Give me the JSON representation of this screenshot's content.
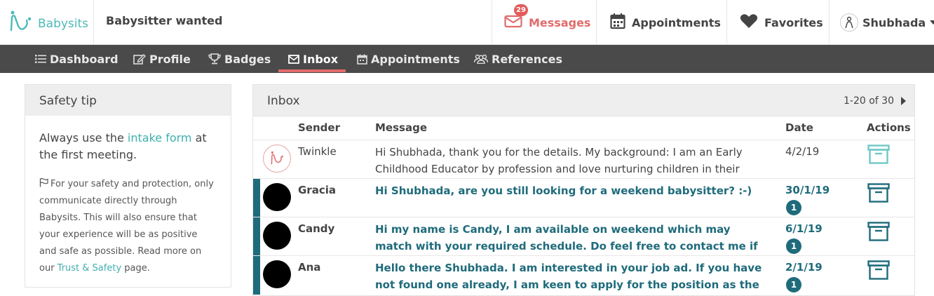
{
  "header": {
    "logo_text": "Babysits",
    "page_title": "Babysitter wanted",
    "messages": {
      "label": "Messages",
      "count": "29"
    },
    "appointments_label": "Appointments",
    "favorites_label": "Favorites",
    "user_name": "Shubhada"
  },
  "nav": {
    "items": [
      {
        "label": "Dashboard",
        "icon": "list-icon"
      },
      {
        "label": "Profile",
        "icon": "edit-icon"
      },
      {
        "label": "Badges",
        "icon": "trophy-icon"
      },
      {
        "label": "Inbox",
        "icon": "envelope-icon",
        "active": true
      },
      {
        "label": "Appointments",
        "icon": "calendar-icon"
      },
      {
        "label": "References",
        "icon": "users-icon"
      }
    ]
  },
  "sidebar": {
    "title": "Safety tip",
    "tip_before": "Always use the ",
    "tip_link": "intake form",
    "tip_after": " at the first meeting.",
    "note_before": "For your safety and protection, only communicate directly through Babysits. This will also ensure that your experience will be as positive and safe as possible. Read more on our ",
    "note_link": "Trust & Safety",
    "note_after": " page."
  },
  "inbox": {
    "title": "Inbox",
    "pager": "1-20 of 30",
    "columns": {
      "sender": "Sender",
      "message": "Message",
      "date": "Date",
      "actions": "Actions"
    },
    "rows": [
      {
        "sender": "Twinkle",
        "message": "Hi Shubhada, thank you for the details. My background: I am an Early Childhood Educator by profession and love nurturing children in their",
        "date": "4/2/19",
        "unread": false,
        "count": ""
      },
      {
        "sender": "Gracia",
        "message": "Hi Shubhada, are you still looking for a weekend babysitter? :-)",
        "date": "30/1/19",
        "unread": true,
        "count": "1"
      },
      {
        "sender": "Candy",
        "message": "Hi my name is Candy, I am available on weekend which may match with your required schedule. Do feel free to contact me if you still",
        "date": "6/1/19",
        "unread": true,
        "count": "1"
      },
      {
        "sender": "Ana",
        "message": "Hello there Shubhada. I am interested in your job ad. If you have not found one already, I am keen to apply for the position as the",
        "date": "2/1/19",
        "unread": true,
        "count": "1"
      }
    ]
  },
  "colors": {
    "brand": "#4dbab8",
    "accent_red": "#e35b5b",
    "unread_teal": "#1f6b7b",
    "nav_bg": "#4a4a4a"
  }
}
